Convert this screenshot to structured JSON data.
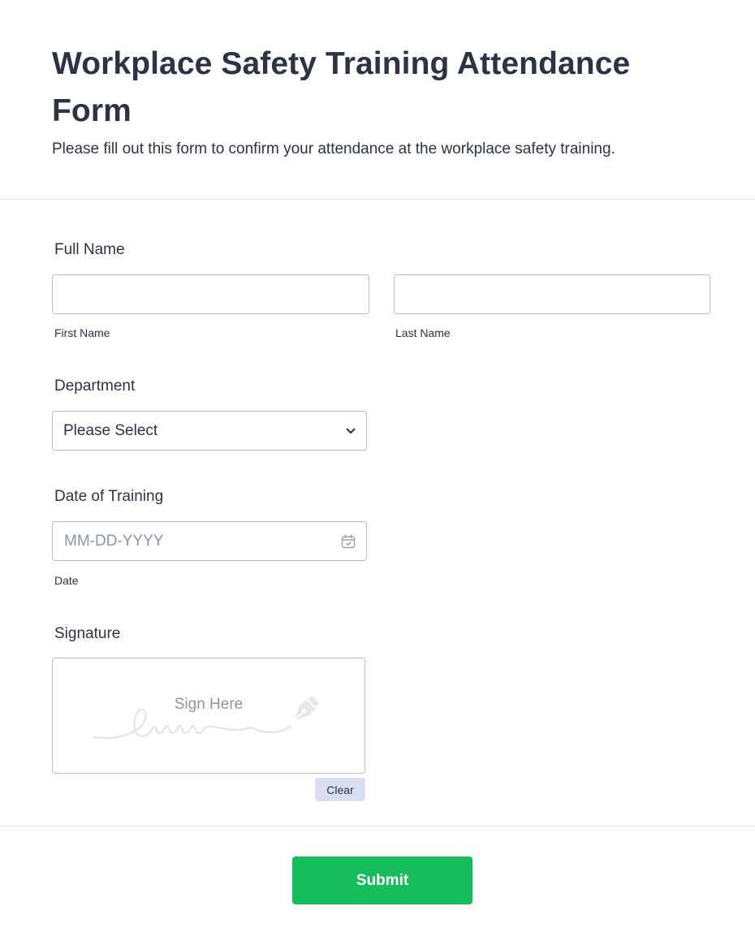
{
  "header": {
    "title": "Workplace Safety Training Attendance Form",
    "subtitle": "Please fill out this form to confirm your attendance at the workplace safety training."
  },
  "full_name": {
    "label": "Full Name",
    "first_name_value": "",
    "last_name_value": "",
    "first_sublabel": "First Name",
    "last_sublabel": "Last Name"
  },
  "department": {
    "label": "Department",
    "selected": "Please Select",
    "icon": "chevron-down-icon"
  },
  "date": {
    "label": "Date of Training",
    "value": "",
    "placeholder": "MM-DD-YYYY",
    "sublabel": "Date",
    "icon": "calendar-icon"
  },
  "signature": {
    "label": "Signature",
    "placeholder": "Sign Here",
    "clear_label": "Clear",
    "icon": "pen-nib-icon"
  },
  "submit": {
    "label": "Submit"
  },
  "colors": {
    "text": "#2c3345",
    "border": "#b8bdc9",
    "placeholder": "#8c94a8",
    "submit_bg": "#18bd5b",
    "clear_bg": "#dadef3",
    "divider": "#e3e5ea"
  }
}
